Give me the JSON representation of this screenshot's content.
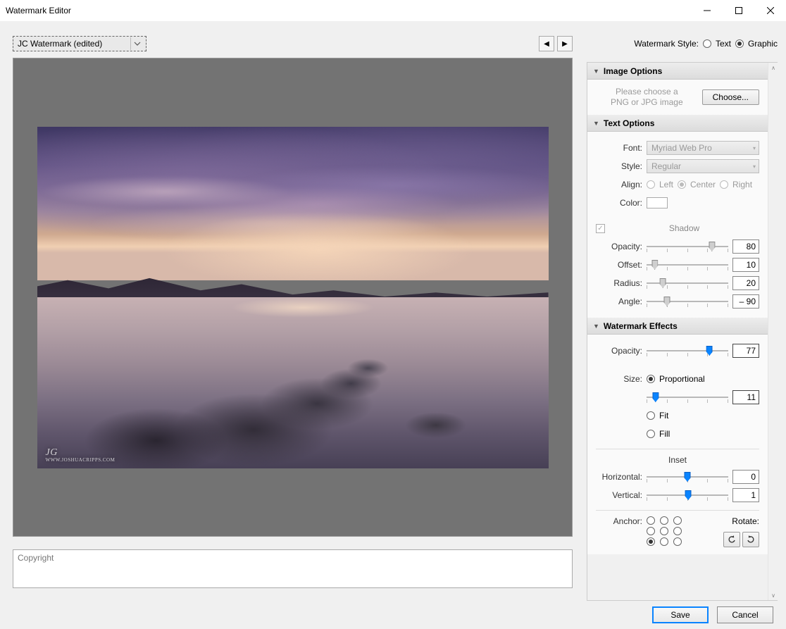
{
  "window": {
    "title": "Watermark Editor"
  },
  "preset": {
    "selected": "JC Watermark (edited)"
  },
  "styleRow": {
    "label": "Watermark Style:",
    "text": "Text",
    "graphic": "Graphic",
    "selected": "graphic"
  },
  "preview": {
    "watermark_sig": "JG",
    "watermark_url": "WWW.JOSHUACRIPPS.COM"
  },
  "copyright": {
    "placeholder": "Copyright"
  },
  "panels": {
    "imageOptions": {
      "title": "Image Options",
      "hint1": "Please choose a",
      "hint2": "PNG or JPG image",
      "choose": "Choose..."
    },
    "textOptions": {
      "title": "Text Options",
      "font_label": "Font:",
      "font_value": "Myriad Web Pro",
      "style_label": "Style:",
      "style_value": "Regular",
      "align_label": "Align:",
      "align_left": "Left",
      "align_center": "Center",
      "align_right": "Right",
      "color_label": "Color:",
      "shadow_title": "Shadow",
      "opacity_label": "Opacity:",
      "opacity_value": "80",
      "offset_label": "Offset:",
      "offset_value": "10",
      "radius_label": "Radius:",
      "radius_value": "20",
      "angle_label": "Angle:",
      "angle_value": "– 90"
    },
    "effects": {
      "title": "Watermark Effects",
      "opacity_label": "Opacity:",
      "opacity_value": "77",
      "size_label": "Size:",
      "size_proportional": "Proportional",
      "size_value": "11",
      "size_fit": "Fit",
      "size_fill": "Fill",
      "inset_title": "Inset",
      "horizontal_label": "Horizontal:",
      "horizontal_value": "0",
      "vertical_label": "Vertical:",
      "vertical_value": "1",
      "anchor_label": "Anchor:",
      "rotate_label": "Rotate:"
    }
  },
  "footer": {
    "save": "Save",
    "cancel": "Cancel"
  }
}
